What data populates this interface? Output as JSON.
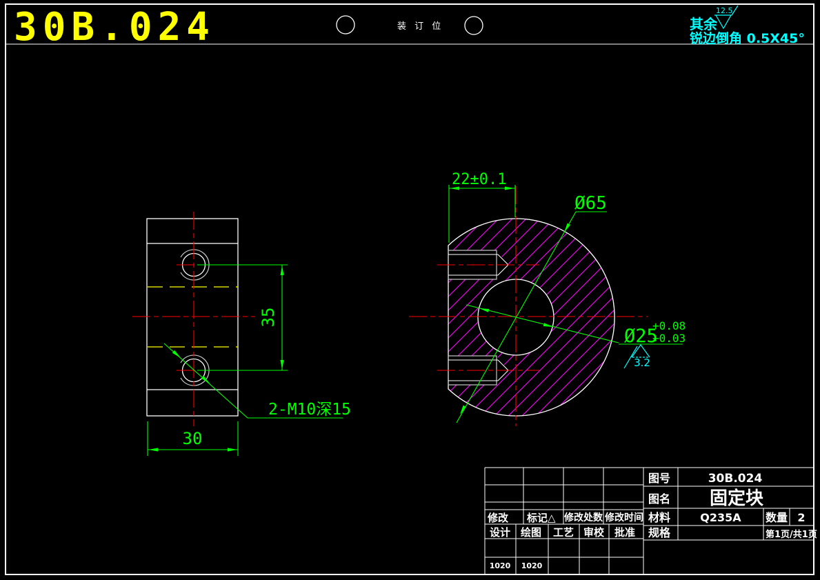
{
  "palette": {
    "background": "#000000",
    "outline": "#ffffff",
    "dimension": "#00ff00",
    "centerline": "#ff0000",
    "hidden": "#ffff00",
    "hatch": "#ff00ff",
    "note": "#00ffff",
    "title": "#ffff00"
  },
  "header": {
    "drawing_number": "30B.024",
    "binding_mark": "装 订 位",
    "rest_label": "其余",
    "rest_roughness": "12.5",
    "edge_chamfer_note": "锐边倒角 0.5X45°"
  },
  "front_view": {
    "hole_spacing_dim": "35",
    "width_dim": "30",
    "thread_callout": "2-M10深15"
  },
  "side_view": {
    "offset_dim": "22±0.1",
    "outer_diameter": "Ø65",
    "bore_diameter": "Ø25",
    "bore_tol_upper": "+0.08",
    "bore_tol_lower": "+0.03",
    "bore_roughness": "3.2"
  },
  "title_block": {
    "labels": {
      "drawing_no": "图号",
      "drawing_name": "图名",
      "material": "材料",
      "quantity": "数量",
      "spec": "规格",
      "modify": "修改",
      "mark": "标记△",
      "modify_count": "修改处数",
      "modify_date": "修改时间",
      "design": "设计",
      "draft": "绘图",
      "process": "工艺",
      "review": "审校",
      "approve": "批准"
    },
    "values": {
      "drawing_no": "30B.024",
      "drawing_name": "固定块",
      "material": "Q235A",
      "quantity": "2",
      "page": "第1页/共1页",
      "code1": "1020",
      "code2": "1020"
    }
  }
}
